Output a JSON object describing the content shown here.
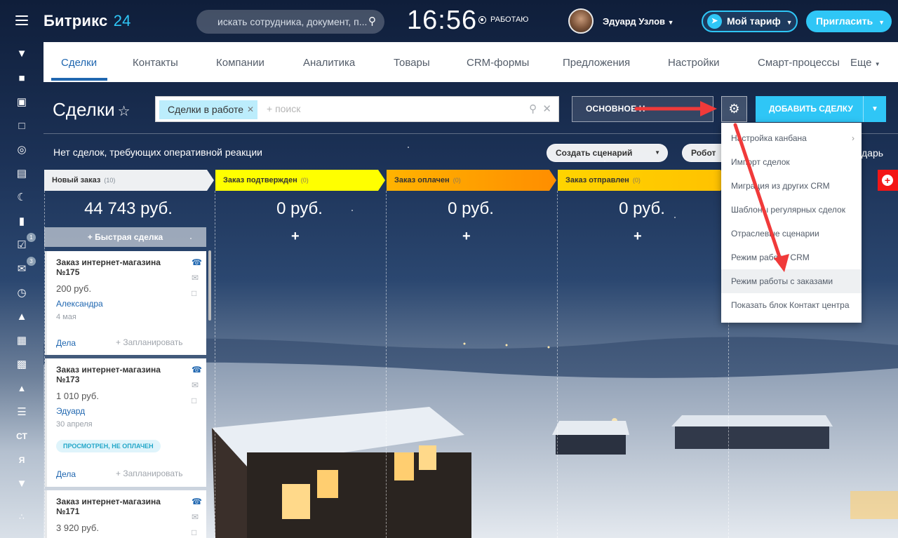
{
  "header": {
    "logo_main": "Битрикс",
    "logo_num": "24",
    "search_placeholder": "искать сотрудника, документ, п...",
    "clock": "16:56",
    "status": "РАБОТАЮ",
    "user_name": "Эдуард Узлов",
    "tarif_label": "Мой тариф",
    "invite_label": "Пригласить"
  },
  "sidebar": {
    "badges": [
      "1",
      "3"
    ],
    "ct_label": "СТ",
    "ya_label": "Я"
  },
  "nav": {
    "items": [
      "Сделки",
      "Контакты",
      "Компании",
      "Аналитика",
      "Товары",
      "CRM-формы",
      "Предложения",
      "Настройки",
      "Смарт-процессы",
      "Еще"
    ]
  },
  "toolbar": {
    "title": "Сделки",
    "filter_chip": "Сделки в работе",
    "filter_plus": "+ поиск",
    "osnov_label": "ОСНОВНОЕ Н",
    "add_deal": "ДОБАВИТЬ СДЕЛКУ"
  },
  "notice": {
    "text": "Нет сделок, требующих оперативной реакции",
    "create_scenario": "Создать сценарий",
    "robots": "Робот",
    "right_fragment": "дарь"
  },
  "stages": [
    {
      "name": "Новый заказ",
      "count": "(10)",
      "sum": "44 743 руб."
    },
    {
      "name": "Заказ подтвержден",
      "count": "(0)",
      "sum": "0 руб."
    },
    {
      "name": "Заказ оплачен",
      "count": "(0)",
      "sum": "0 руб."
    },
    {
      "name": "Заказ отправлен",
      "count": "(0)",
      "sum": "0 руб."
    }
  ],
  "quick_deal": "Быстрая сделка",
  "cards": [
    {
      "title": "Заказ интернет-магазина №175",
      "price": "200 руб.",
      "user": "Александра",
      "date": "4 мая",
      "dela": "Дела",
      "plan": "+ Запланировать"
    },
    {
      "title": "Заказ интернет-магазина №173",
      "price": "1 010 руб.",
      "user": "Эдуард",
      "date": "30 апреля",
      "tag": "ПРОСМОТРЕН, НЕ ОПЛАЧЕН",
      "dela": "Дела",
      "plan": "+ Запланировать"
    },
    {
      "title": "Заказ интернет-магазина №171",
      "price": "3 920 руб."
    }
  ],
  "menu": {
    "items": [
      "Настройка канбана",
      "Импорт сделок",
      "Миграция из других CRM",
      "Шаблоны регулярных сделок",
      "Отраслевые сценарии",
      "Режим работы CRM",
      "Режим работы с заказами",
      "Показать блок Контакт центра"
    ]
  },
  "colors": {
    "accent": "#2fc6f6",
    "link": "#2067b0",
    "stage_new": "#eef0f2",
    "stage_confirmed": "#ffff00",
    "stage_paid": "#ff8f00",
    "stage_sent": "#ffc200",
    "stage_red": "#f31616",
    "arrow": "#f03a3a"
  }
}
